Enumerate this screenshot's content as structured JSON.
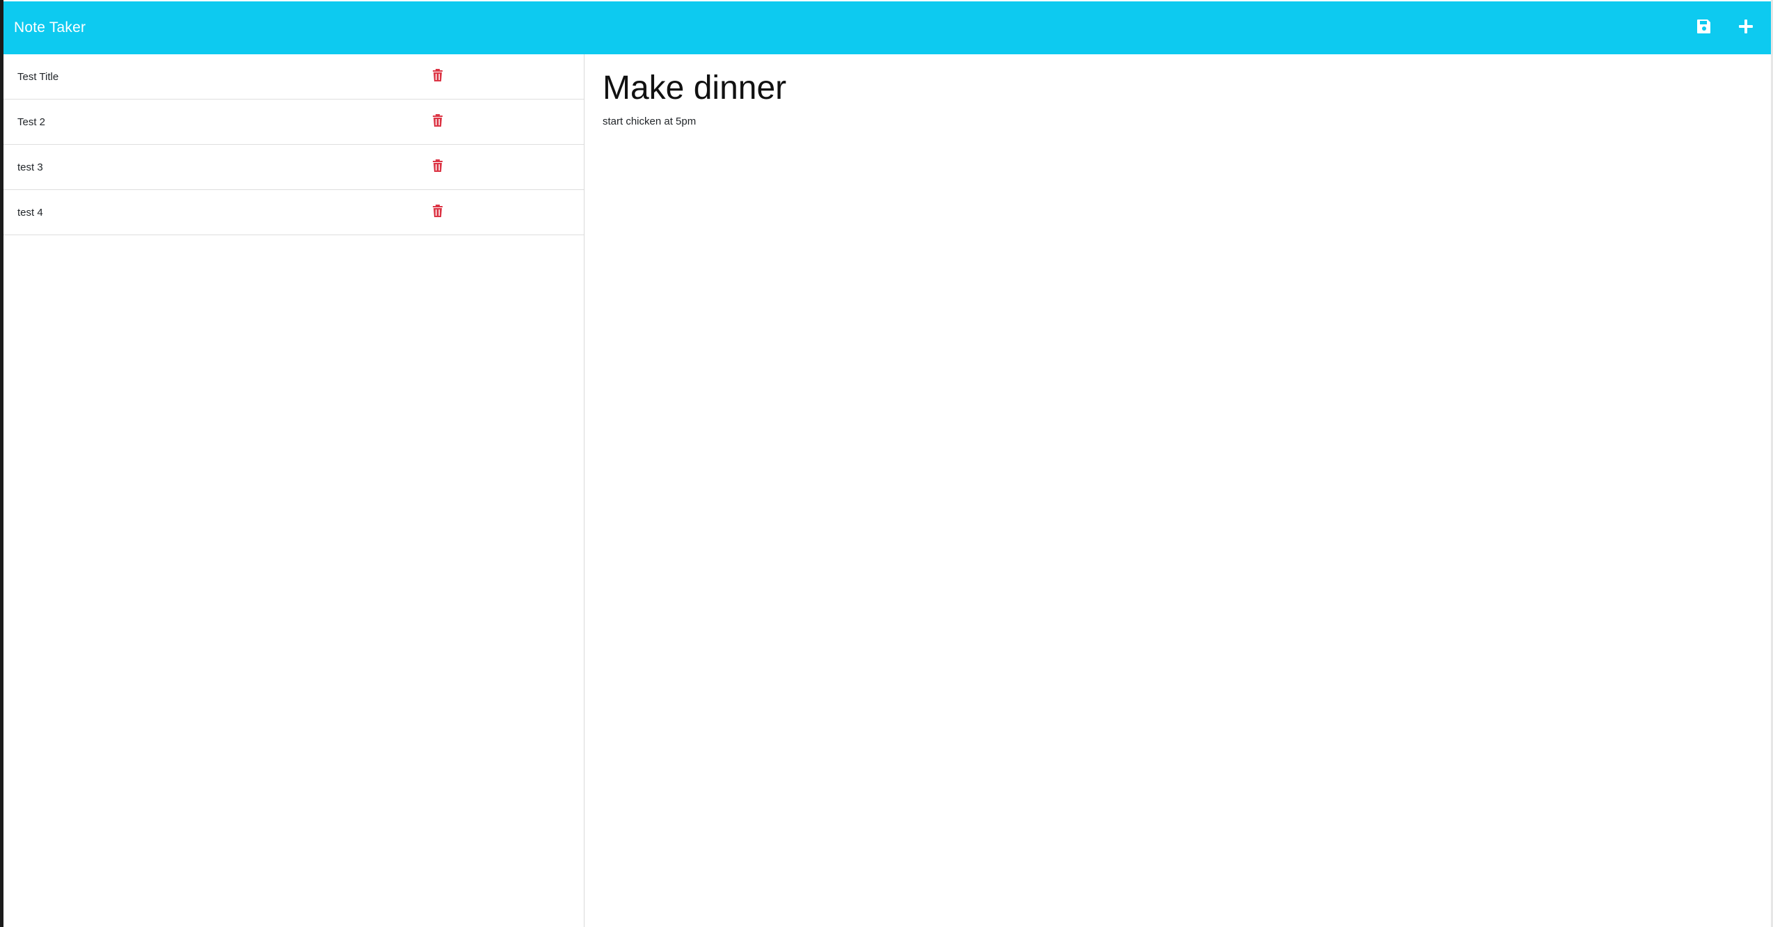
{
  "navbar": {
    "brand": "Note Taker",
    "save_icon": "save-icon",
    "add_icon": "plus-icon",
    "bg_color": "#0dcaf0"
  },
  "notes": [
    {
      "title": "Test Title",
      "delete_icon": "trash-icon"
    },
    {
      "title": "Test 2",
      "delete_icon": "trash-icon"
    },
    {
      "title": "test 3",
      "delete_icon": "trash-icon"
    },
    {
      "title": "test 4",
      "delete_icon": "trash-icon"
    }
  ],
  "editor": {
    "title": "Make dinner",
    "body": "start chicken at 5pm"
  },
  "colors": {
    "delete": "#dc3545",
    "accent": "#0dcaf0"
  }
}
